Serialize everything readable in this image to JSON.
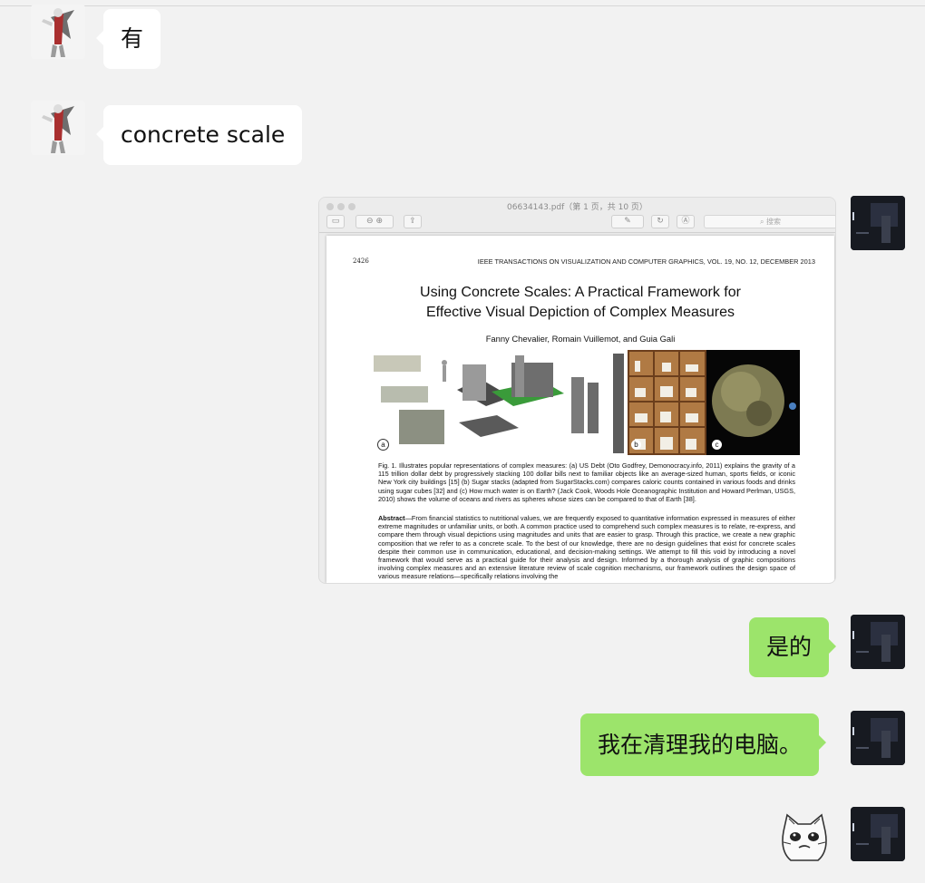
{
  "messages": {
    "m1": {
      "text": "有"
    },
    "m2": {
      "text": "concrete scale"
    },
    "m4": {
      "text": "是的"
    },
    "m5": {
      "text": "我在清理我的电脑。"
    }
  },
  "preview": {
    "window_title": "06634143.pdf（第 1 页，共 10 页）",
    "search_placeholder": "搜索",
    "page_number": "2426",
    "journal": "IEEE TRANSACTIONS ON VISUALIZATION AND COMPUTER GRAPHICS, VOL. 19, NO. 12, DECEMBER 2013",
    "title_line1": "Using Concrete Scales: A Practical Framework for",
    "title_line2": "Effective Visual Depiction of Complex Measures",
    "authors": "Fanny Chevalier, Romain Vuillemot, and Guia Gali",
    "figure_labels": [
      "a",
      "b",
      "c"
    ],
    "caption": "Fig. 1. Illustrates popular representations of complex measures: (a) US Debt (Oto Godfrey, Demonocracy.info, 2011) explains the gravity of a 115 trillion dollar debt by progressively stacking 100 dollar bills next to familiar objects like an average-sized human, sports fields, or iconic New York city buildings [15] (b) Sugar stacks (adapted from SugarStacks.com) compares caloric counts contained in various foods and drinks using sugar cubes [32] and (c) How much water is on Earth? (Jack Cook, Woods Hole Oceanographic Institution and Howard Perlman, USGS, 2010) shows the volume of oceans and rivers as spheres whose sizes can be compared to that of Earth [38].",
    "abstract_head": "Abstract",
    "abstract_body": "—From financial statistics to nutritional values, we are frequently exposed to quantitative information expressed in measures of either extreme magnitudes or unfamiliar units, or both. A common practice used to comprehend such complex measures is to relate, re-express, and compare them through visual depictions using magnitudes and units that are easier to grasp. Through this practice, we create a new graphic composition that we refer to as a concrete scale. To the best of our knowledge, there are no design guidelines that exist for concrete scales despite their common use in communication, educational, and decision-making settings. We attempt to fill this void by introducing a novel framework that would serve as a practical guide for their analysis and design. Informed by a thorough analysis of graphic compositions involving complex measures and an extensive literature review of scale cognition mechanisms, our framework outlines the design space of various measure relations—specifically relations involving the"
  },
  "colors": {
    "background": "#f2f2f2",
    "incoming_bubble": "#ffffff",
    "outgoing_bubble": "#9ce46b"
  },
  "icons": [
    "contact-avatar",
    "user-avatar",
    "cat-face-sticker",
    "zoom-out-icon",
    "zoom-in-icon",
    "share-icon",
    "pen-icon",
    "rotate-icon",
    "markup-icon",
    "search-icon"
  ]
}
